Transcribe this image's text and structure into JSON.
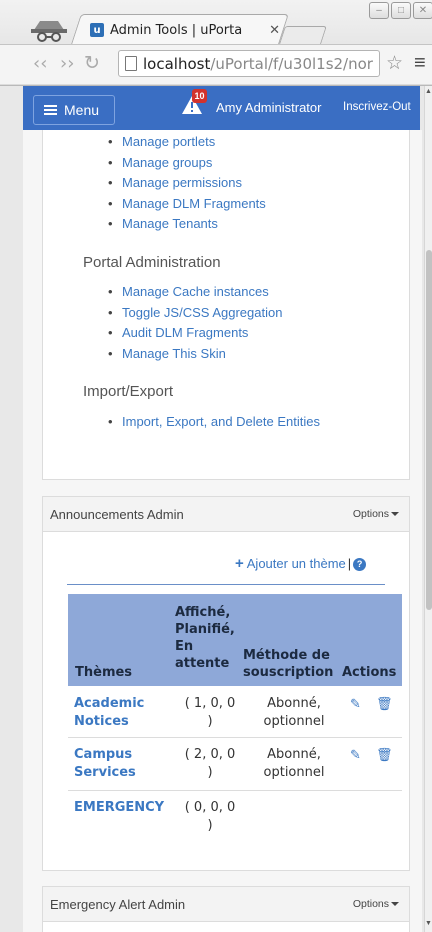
{
  "browser": {
    "tab_title": "Admin Tools | uPorta",
    "tab_favicon_letter": "u",
    "url_host": "localhost",
    "url_path": "/uPortal/f/u30l1s2/nor"
  },
  "header": {
    "menu_label": "Menu",
    "notification_count": "10",
    "user_name": "Amy Administrator",
    "logout_label": "Inscrivez-Out"
  },
  "admin_tools": {
    "group_items": [
      "Manage portlets",
      "Manage groups",
      "Manage permissions",
      "Manage DLM Fragments",
      "Manage Tenants"
    ],
    "portal_admin_heading": "Portal Administration",
    "portal_admin_items": [
      "Manage Cache instances",
      "Toggle JS/CSS Aggregation",
      "Audit DLM Fragments",
      "Manage This Skin"
    ],
    "import_export_heading": "Import/Export",
    "import_export_items": [
      "Import, Export, and Delete Entities"
    ]
  },
  "announcements": {
    "title": "Announcements Admin",
    "options_label": "Options",
    "add_theme_label": "Ajouter un thème",
    "help_symbol": "?",
    "columns": {
      "themes": "Thèmes",
      "status_line1": "Affiché,",
      "status_line2": "Planifié,",
      "status_line3": "En",
      "status_line4": "attente",
      "sub_line1": "Méthode de",
      "sub_line2": "souscription",
      "actions": "Actions"
    },
    "rows": [
      {
        "name_line1": "Academic",
        "name_line2": "Notices",
        "status_line1": "( 1, 0, 0",
        "status_line2": ")",
        "sub_line1": "Abonné,",
        "sub_line2": "optionnel"
      },
      {
        "name_line1": "Campus",
        "name_line2": "Services",
        "status_line1": "( 2, 0, 0",
        "status_line2": ")",
        "sub_line1": "Abonné,",
        "sub_line2": "optionnel"
      },
      {
        "name_line1": "EMERGENCY",
        "name_line2": "",
        "status_line1": "( 0, 0, 0",
        "status_line2": ")",
        "sub_line1": "",
        "sub_line2": ""
      }
    ]
  },
  "emergency": {
    "title": "Emergency Alert Admin",
    "options_label": "Options"
  }
}
